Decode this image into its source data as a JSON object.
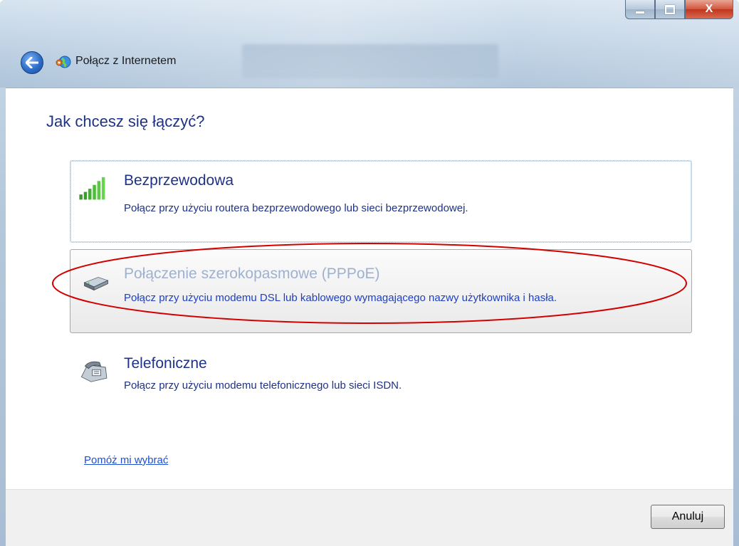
{
  "window": {
    "nav_title": "Połącz z Internetem",
    "close_glyph": "X"
  },
  "main": {
    "heading": "Jak chcesz się łączyć?",
    "options": [
      {
        "title": "Bezprzewodowa",
        "description": "Połącz przy użyciu routera bezprzewodowego lub sieci bezprzewodowej.",
        "icon": "signal-bars-icon",
        "state": "focused"
      },
      {
        "title": "Połączenie szerokopasmowe (PPPoE)",
        "description": "Połącz przy użyciu modemu DSL lub kablowego wymagającego nazwy użytkownika i hasła.",
        "icon": "broadband-modem-icon",
        "state": "hover",
        "annotation": "red-ellipse-highlight"
      },
      {
        "title": "Telefoniczne",
        "description": "Połącz przy użyciu modemu telefonicznego lub sieci ISDN.",
        "icon": "dialup-phone-icon",
        "state": "normal"
      }
    ],
    "help_link": "Pomóż mi wybrać"
  },
  "footer": {
    "cancel_label": "Anuluj"
  },
  "colors": {
    "heading": "#1e3287",
    "link": "#1f4fcf",
    "highlight_ellipse": "#d40000"
  }
}
